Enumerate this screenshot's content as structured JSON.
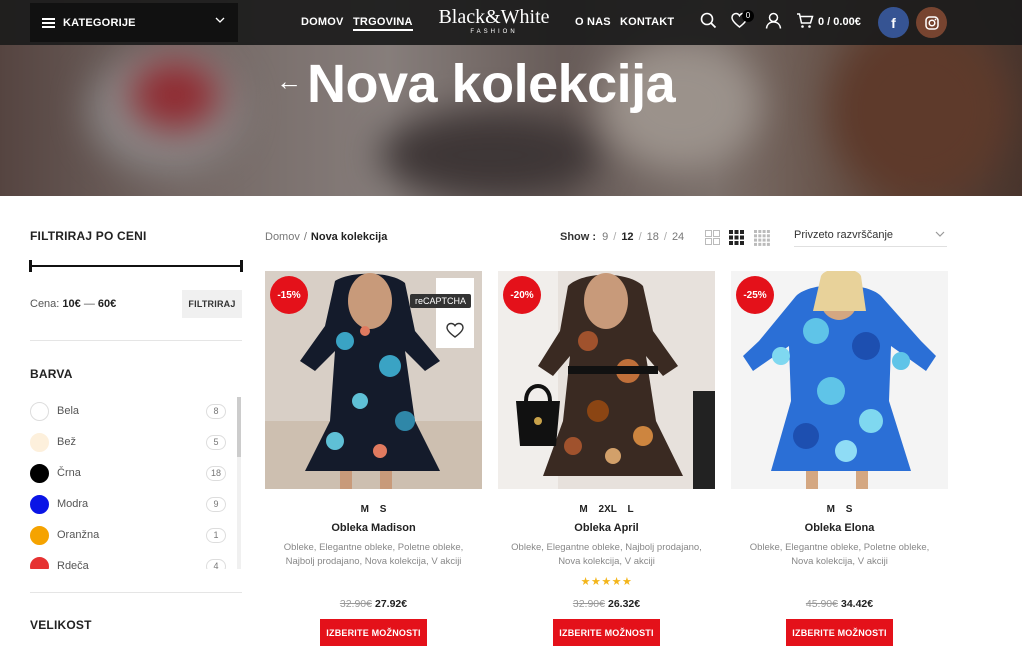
{
  "header": {
    "categories_label": "KATEGORIJE",
    "nav": [
      {
        "label": "DOMOV"
      },
      {
        "label": "TRGOVINA"
      },
      {
        "label": "O NAS"
      },
      {
        "label": "KONTAKT"
      }
    ],
    "logo_main": "Black&White",
    "logo_sub": "FASHION",
    "wishlist_count": "0",
    "cart_text": "0 / 0.00€",
    "icons": [
      "menu-icon",
      "chevron-down-icon",
      "search-icon",
      "heart-icon",
      "user-icon",
      "cart-icon",
      "facebook-icon",
      "instagram-icon"
    ],
    "colors": {
      "facebook": "#365493",
      "instagram": "#774430"
    }
  },
  "hero": {
    "back_arrow": "←",
    "title": "Nova kolekcija"
  },
  "sidebar": {
    "price_filter_title": "FILTRIRAJ PO CENI",
    "price_label": "Cena:",
    "price_min": "10€",
    "price_max": "60€",
    "price_sep": " — ",
    "filter_button": "FILTRIRAJ",
    "color_title": "BARVA",
    "colors": [
      {
        "name": "Bela",
        "count": "8",
        "hex": "#ffffff"
      },
      {
        "name": "Bež",
        "count": "5",
        "hex": "#fdf0dc"
      },
      {
        "name": "Črna",
        "count": "18",
        "hex": "#000000"
      },
      {
        "name": "Modra",
        "count": "9",
        "hex": "#0a14e6"
      },
      {
        "name": "Oranžna",
        "count": "1",
        "hex": "#f5a300"
      },
      {
        "name": "Rdeča",
        "count": "4",
        "hex": "#e63232"
      }
    ],
    "size_title": "VELIKOST"
  },
  "toolbar": {
    "breadcrumb_home": "Domov",
    "breadcrumb_sep": "/",
    "breadcrumb_current": "Nova kolekcija",
    "show_label": "Show :",
    "per_page": [
      {
        "value": "9",
        "active": false
      },
      {
        "value": "12",
        "active": true
      },
      {
        "value": "18",
        "active": false
      },
      {
        "value": "24",
        "active": false
      }
    ],
    "view_icons": [
      "grid-2-icon",
      "grid-3-icon",
      "grid-4-icon"
    ],
    "sort_label": "Privzeto razvrščanje"
  },
  "products": [
    {
      "badge": "-15%",
      "sizes": "M S",
      "name": "Obleka Madison",
      "categories": "Obleke, Elegantne obleke, Poletne obleke, Najbolj prodajano, Nova kolekcija, V akciji",
      "rating": "",
      "old_price": "32.90€",
      "new_price": "27.92€",
      "button": "IZBERITE MOŽNOSTI",
      "overlay_tooltip": "reCAPTCHA"
    },
    {
      "badge": "-20%",
      "sizes": "M 2XL L",
      "name": "Obleka April",
      "categories": "Obleke, Elegantne obleke, Najbolj prodajano, Nova kolekcija, V akciji",
      "rating": "★★★★★",
      "rating_value": 5,
      "old_price": "32.90€",
      "new_price": "26.32€",
      "button": "IZBERITE MOŽNOSTI"
    },
    {
      "badge": "-25%",
      "sizes": "M S",
      "name": "Obleka Elona",
      "categories": "Obleke, Elegantne obleke, Poletne obleke, Nova kolekcija, V akciji",
      "rating": "",
      "old_price": "45.90€",
      "new_price": "34.42€",
      "button": "IZBERITE MOŽNOSTI"
    }
  ],
  "accent_color": "#e4111a"
}
